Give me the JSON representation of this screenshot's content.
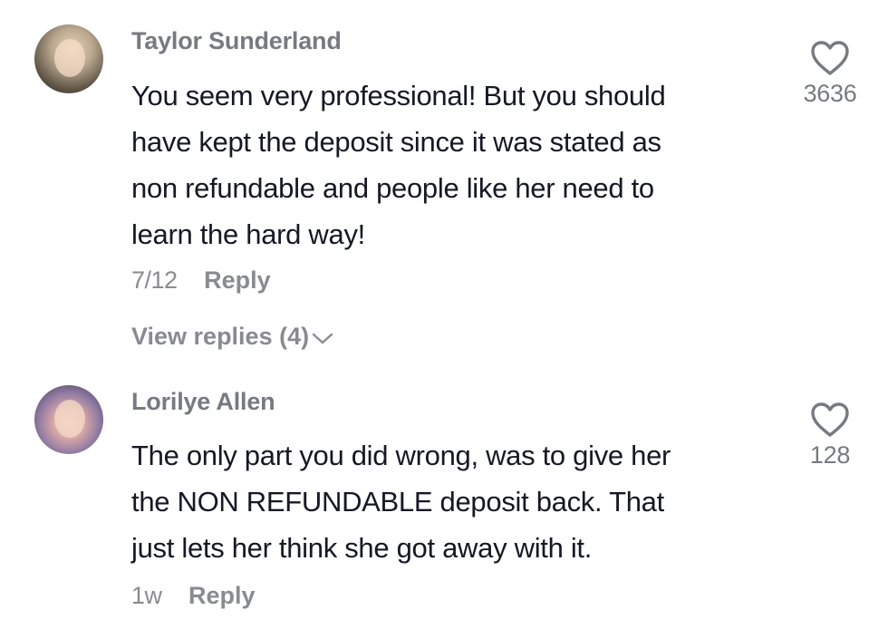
{
  "comments": [
    {
      "username": "Taylor Sunderland",
      "lines": [
        "You seem very professional! But you should",
        "have kept the deposit since it was stated as",
        "non refundable and people like her need to",
        "learn the hard way!"
      ],
      "time": "7/12",
      "reply_label": "Reply",
      "likes": "3636",
      "view_replies_label": "View replies (4)"
    },
    {
      "username": "Lorilye Allen",
      "lines": [
        "The only part you did wrong, was to give her",
        "the NON REFUNDABLE deposit back. That",
        "just lets her think she got away with it."
      ],
      "time": "1w",
      "reply_label": "Reply",
      "likes": "128"
    }
  ],
  "icons": {
    "like": "heart-outline-icon",
    "expand": "chevron-down-icon"
  },
  "colors": {
    "text": "#161823",
    "secondary": "#8a8b91",
    "username": "#777a80"
  }
}
